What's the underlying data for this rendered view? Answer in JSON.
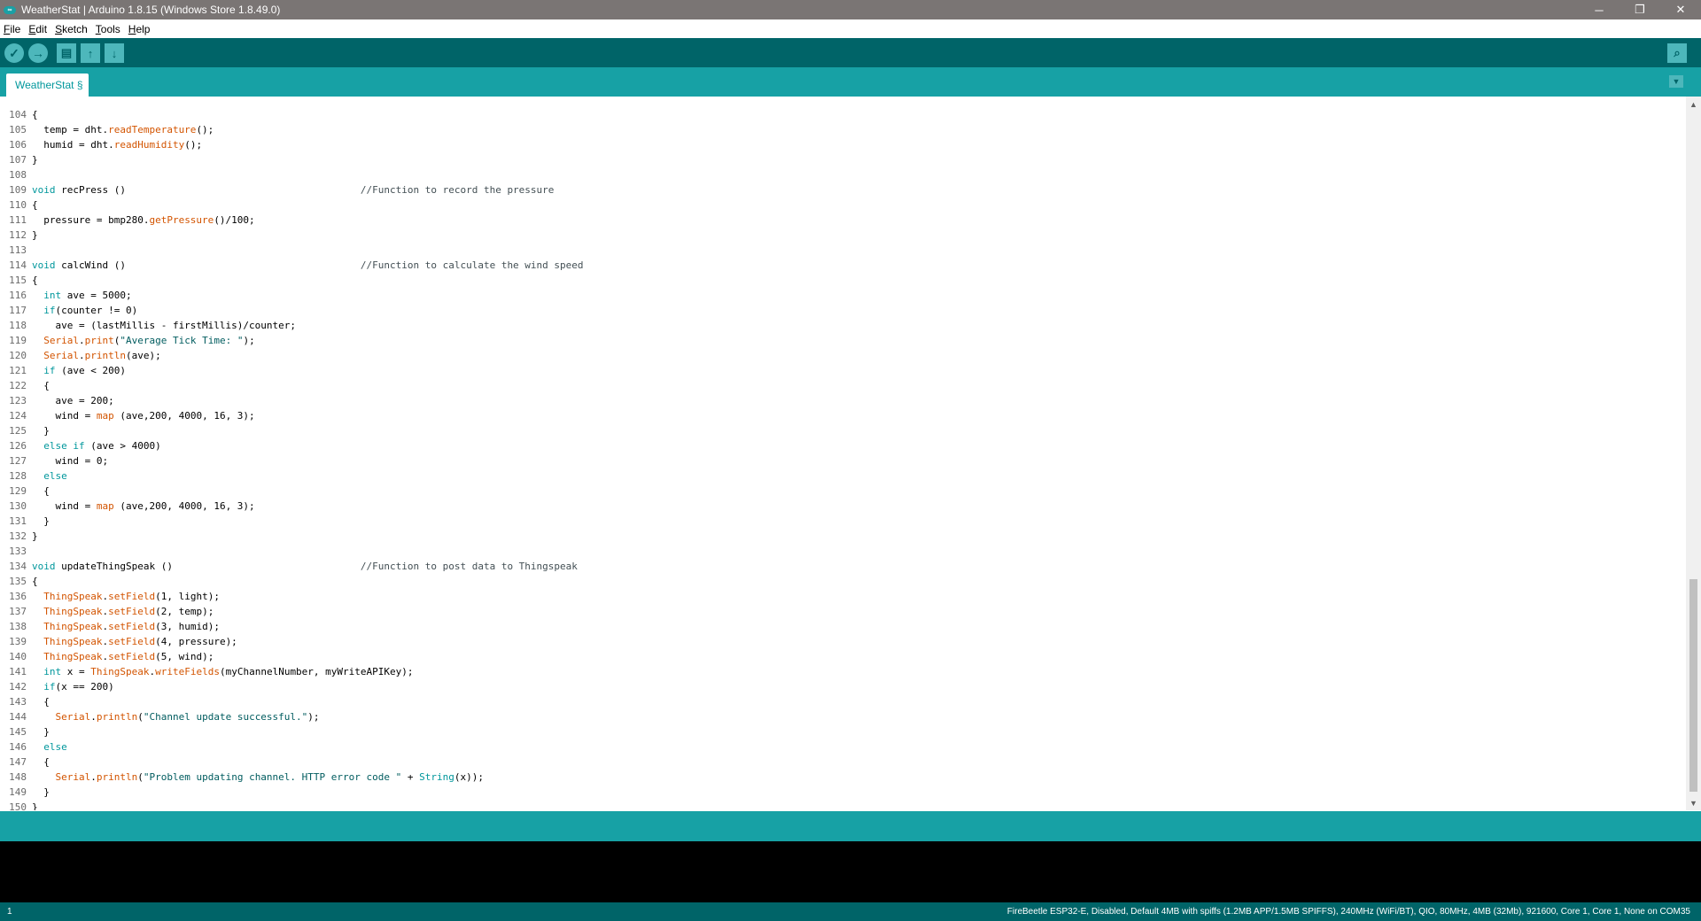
{
  "window": {
    "title": "WeatherStat | Arduino 1.8.15 (Windows Store 1.8.49.0)",
    "minimize_glyph": "─",
    "restore_glyph": "❐",
    "close_glyph": "✕"
  },
  "menu": [
    {
      "underline": "F",
      "rest": "ile"
    },
    {
      "underline": "E",
      "rest": "dit"
    },
    {
      "underline": "S",
      "rest": "ketch"
    },
    {
      "underline": "T",
      "rest": "ools"
    },
    {
      "underline": "H",
      "rest": "elp"
    }
  ],
  "toolbar": {
    "verify_icon": "check-icon",
    "upload_icon": "arrow-right-icon",
    "new_icon": "new-file-icon",
    "open_icon": "arrow-up-icon",
    "save_icon": "arrow-down-icon",
    "serial_monitor_icon": "magnifier-icon",
    "verify_glyph": "✓",
    "upload_glyph": "→",
    "new_glyph": "▤",
    "open_glyph": "↑",
    "save_glyph": "↓",
    "serial_glyph": "⌕"
  },
  "tab": {
    "label": "WeatherStat §",
    "menu_glyph": "▼"
  },
  "code_lines": [
    {
      "n": "104",
      "tokens": [
        {
          "t": "{",
          "c": ""
        }
      ]
    },
    {
      "n": "105",
      "tokens": [
        {
          "t": "  temp = dht.",
          "c": ""
        },
        {
          "t": "readTemperature",
          "c": "fn"
        },
        {
          "t": "();",
          "c": ""
        }
      ]
    },
    {
      "n": "106",
      "tokens": [
        {
          "t": "  humid = dht.",
          "c": ""
        },
        {
          "t": "readHumidity",
          "c": "fn"
        },
        {
          "t": "();",
          "c": ""
        }
      ]
    },
    {
      "n": "107",
      "tokens": [
        {
          "t": "}",
          "c": ""
        }
      ]
    },
    {
      "n": "108",
      "tokens": []
    },
    {
      "n": "109",
      "tokens": [
        {
          "t": "void",
          "c": "kw"
        },
        {
          "t": " recPress ()                                        ",
          "c": ""
        },
        {
          "t": "//Function to record the pressure",
          "c": "cm"
        }
      ]
    },
    {
      "n": "110",
      "tokens": [
        {
          "t": "{",
          "c": ""
        }
      ]
    },
    {
      "n": "111",
      "tokens": [
        {
          "t": "  pressure = bmp280.",
          "c": ""
        },
        {
          "t": "getPressure",
          "c": "fn"
        },
        {
          "t": "()/100;",
          "c": ""
        }
      ]
    },
    {
      "n": "112",
      "tokens": [
        {
          "t": "}",
          "c": ""
        }
      ]
    },
    {
      "n": "113",
      "tokens": []
    },
    {
      "n": "114",
      "tokens": [
        {
          "t": "void",
          "c": "kw"
        },
        {
          "t": " calcWind ()                                        ",
          "c": ""
        },
        {
          "t": "//Function to calculate the wind speed",
          "c": "cm"
        }
      ]
    },
    {
      "n": "115",
      "tokens": [
        {
          "t": "{",
          "c": ""
        }
      ]
    },
    {
      "n": "116",
      "tokens": [
        {
          "t": "  ",
          "c": ""
        },
        {
          "t": "int",
          "c": "kw"
        },
        {
          "t": " ave = 5000;",
          "c": ""
        }
      ]
    },
    {
      "n": "117",
      "tokens": [
        {
          "t": "  ",
          "c": ""
        },
        {
          "t": "if",
          "c": "kw"
        },
        {
          "t": "(counter != 0)",
          "c": ""
        }
      ]
    },
    {
      "n": "118",
      "tokens": [
        {
          "t": "    ave = (lastMillis - firstMillis)/counter;",
          "c": ""
        }
      ]
    },
    {
      "n": "119",
      "tokens": [
        {
          "t": "  ",
          "c": ""
        },
        {
          "t": "Serial",
          "c": "cls"
        },
        {
          "t": ".",
          "c": ""
        },
        {
          "t": "print",
          "c": "fn"
        },
        {
          "t": "(",
          "c": ""
        },
        {
          "t": "\"Average Tick Time: \"",
          "c": "str"
        },
        {
          "t": ");",
          "c": ""
        }
      ]
    },
    {
      "n": "120",
      "tokens": [
        {
          "t": "  ",
          "c": ""
        },
        {
          "t": "Serial",
          "c": "cls"
        },
        {
          "t": ".",
          "c": ""
        },
        {
          "t": "println",
          "c": "fn"
        },
        {
          "t": "(ave);",
          "c": ""
        }
      ]
    },
    {
      "n": "121",
      "tokens": [
        {
          "t": "  ",
          "c": ""
        },
        {
          "t": "if",
          "c": "kw"
        },
        {
          "t": " (ave < 200)",
          "c": ""
        }
      ]
    },
    {
      "n": "122",
      "tokens": [
        {
          "t": "  {",
          "c": ""
        }
      ]
    },
    {
      "n": "123",
      "tokens": [
        {
          "t": "    ave = 200;",
          "c": ""
        }
      ]
    },
    {
      "n": "124",
      "tokens": [
        {
          "t": "    wind = ",
          "c": ""
        },
        {
          "t": "map",
          "c": "fn"
        },
        {
          "t": " (ave,200, 4000, 16, 3);",
          "c": ""
        }
      ]
    },
    {
      "n": "125",
      "tokens": [
        {
          "t": "  }",
          "c": ""
        }
      ]
    },
    {
      "n": "126",
      "tokens": [
        {
          "t": "  ",
          "c": ""
        },
        {
          "t": "else",
          "c": "kw"
        },
        {
          "t": " ",
          "c": ""
        },
        {
          "t": "if",
          "c": "kw"
        },
        {
          "t": " (ave > 4000)",
          "c": ""
        }
      ]
    },
    {
      "n": "127",
      "tokens": [
        {
          "t": "    wind = 0;",
          "c": ""
        }
      ]
    },
    {
      "n": "128",
      "tokens": [
        {
          "t": "  ",
          "c": ""
        },
        {
          "t": "else",
          "c": "kw"
        }
      ]
    },
    {
      "n": "129",
      "tokens": [
        {
          "t": "  {",
          "c": ""
        }
      ]
    },
    {
      "n": "130",
      "tokens": [
        {
          "t": "    wind = ",
          "c": ""
        },
        {
          "t": "map",
          "c": "fn"
        },
        {
          "t": " (ave,200, 4000, 16, 3);",
          "c": ""
        }
      ]
    },
    {
      "n": "131",
      "tokens": [
        {
          "t": "  }",
          "c": ""
        }
      ]
    },
    {
      "n": "132",
      "tokens": [
        {
          "t": "}",
          "c": ""
        }
      ]
    },
    {
      "n": "133",
      "tokens": []
    },
    {
      "n": "134",
      "tokens": [
        {
          "t": "void",
          "c": "kw"
        },
        {
          "t": " updateThingSpeak ()                                ",
          "c": ""
        },
        {
          "t": "//Function to post data to Thingspeak",
          "c": "cm"
        }
      ]
    },
    {
      "n": "135",
      "tokens": [
        {
          "t": "{",
          "c": ""
        }
      ]
    },
    {
      "n": "136",
      "tokens": [
        {
          "t": "  ",
          "c": ""
        },
        {
          "t": "ThingSpeak",
          "c": "cls"
        },
        {
          "t": ".",
          "c": ""
        },
        {
          "t": "setField",
          "c": "fn"
        },
        {
          "t": "(1, light);",
          "c": ""
        }
      ]
    },
    {
      "n": "137",
      "tokens": [
        {
          "t": "  ",
          "c": ""
        },
        {
          "t": "ThingSpeak",
          "c": "cls"
        },
        {
          "t": ".",
          "c": ""
        },
        {
          "t": "setField",
          "c": "fn"
        },
        {
          "t": "(2, temp);",
          "c": ""
        }
      ]
    },
    {
      "n": "138",
      "tokens": [
        {
          "t": "  ",
          "c": ""
        },
        {
          "t": "ThingSpeak",
          "c": "cls"
        },
        {
          "t": ".",
          "c": ""
        },
        {
          "t": "setField",
          "c": "fn"
        },
        {
          "t": "(3, humid);",
          "c": ""
        }
      ]
    },
    {
      "n": "139",
      "tokens": [
        {
          "t": "  ",
          "c": ""
        },
        {
          "t": "ThingSpeak",
          "c": "cls"
        },
        {
          "t": ".",
          "c": ""
        },
        {
          "t": "setField",
          "c": "fn"
        },
        {
          "t": "(4, pressure);",
          "c": ""
        }
      ]
    },
    {
      "n": "140",
      "tokens": [
        {
          "t": "  ",
          "c": ""
        },
        {
          "t": "ThingSpeak",
          "c": "cls"
        },
        {
          "t": ".",
          "c": ""
        },
        {
          "t": "setField",
          "c": "fn"
        },
        {
          "t": "(5, wind);",
          "c": ""
        }
      ]
    },
    {
      "n": "141",
      "tokens": [
        {
          "t": "  ",
          "c": ""
        },
        {
          "t": "int",
          "c": "kw"
        },
        {
          "t": " x = ",
          "c": ""
        },
        {
          "t": "ThingSpeak",
          "c": "cls"
        },
        {
          "t": ".",
          "c": ""
        },
        {
          "t": "writeFields",
          "c": "fn"
        },
        {
          "t": "(myChannelNumber, myWriteAPIKey);",
          "c": ""
        }
      ]
    },
    {
      "n": "142",
      "tokens": [
        {
          "t": "  ",
          "c": ""
        },
        {
          "t": "if",
          "c": "kw"
        },
        {
          "t": "(x == 200)",
          "c": ""
        }
      ]
    },
    {
      "n": "143",
      "tokens": [
        {
          "t": "  {",
          "c": ""
        }
      ]
    },
    {
      "n": "144",
      "tokens": [
        {
          "t": "    ",
          "c": ""
        },
        {
          "t": "Serial",
          "c": "cls"
        },
        {
          "t": ".",
          "c": ""
        },
        {
          "t": "println",
          "c": "fn"
        },
        {
          "t": "(",
          "c": ""
        },
        {
          "t": "\"Channel update successful.\"",
          "c": "str"
        },
        {
          "t": ");",
          "c": ""
        }
      ]
    },
    {
      "n": "145",
      "tokens": [
        {
          "t": "  }",
          "c": ""
        }
      ]
    },
    {
      "n": "146",
      "tokens": [
        {
          "t": "  ",
          "c": ""
        },
        {
          "t": "else",
          "c": "kw"
        }
      ]
    },
    {
      "n": "147",
      "tokens": [
        {
          "t": "  {",
          "c": ""
        }
      ]
    },
    {
      "n": "148",
      "tokens": [
        {
          "t": "    ",
          "c": ""
        },
        {
          "t": "Serial",
          "c": "cls"
        },
        {
          "t": ".",
          "c": ""
        },
        {
          "t": "println",
          "c": "fn"
        },
        {
          "t": "(",
          "c": ""
        },
        {
          "t": "\"Problem updating channel. HTTP error code \"",
          "c": "str"
        },
        {
          "t": " + ",
          "c": ""
        },
        {
          "t": "String",
          "c": "kw"
        },
        {
          "t": "(x));",
          "c": ""
        }
      ]
    },
    {
      "n": "149",
      "tokens": [
        {
          "t": "  }",
          "c": ""
        }
      ]
    },
    {
      "n": "150",
      "tokens": [
        {
          "t": "}",
          "c": ""
        }
      ]
    }
  ],
  "scrollbar": {
    "up_glyph": "▲",
    "down_glyph": "▼"
  },
  "status": {
    "line_number": "1",
    "board_info": "FireBeetle ESP32-E, Disabled, Default 4MB with spiffs (1.2MB APP/1.5MB SPIFFS), 240MHz (WiFi/BT), QIO, 80MHz, 4MB (32Mb), 921600, Core 1, Core 1, None on COM35"
  },
  "colors": {
    "title_bar": "#7a7574",
    "toolbar": "#006468",
    "tab_bar": "#17a1a5",
    "keyword": "#00979c",
    "function": "#d35400",
    "string": "#005c5f",
    "comment": "#434f54"
  }
}
